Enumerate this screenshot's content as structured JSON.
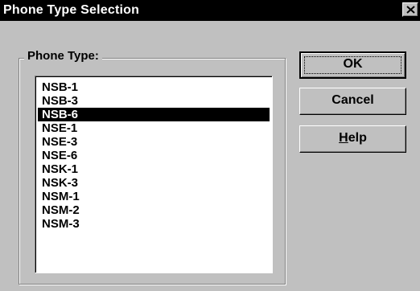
{
  "window": {
    "title": "Phone Type Selection",
    "close_icon": "close-icon"
  },
  "group": {
    "label": "Phone Type:"
  },
  "list": {
    "items": [
      "NSB-1",
      "NSB-3",
      "NSB-6",
      "NSE-1",
      "NSE-3",
      "NSE-6",
      "NSK-1",
      "NSK-3",
      "NSM-1",
      "NSM-2",
      "NSM-3"
    ],
    "selected": "NSB-6"
  },
  "buttons": {
    "ok_label": "OK",
    "cancel_label": "Cancel",
    "help_label_mnemonic": "H",
    "help_label_rest": "elp"
  },
  "colors": {
    "face": "#c0c0c0",
    "titlebar": "#000000",
    "selection": "#000000"
  }
}
